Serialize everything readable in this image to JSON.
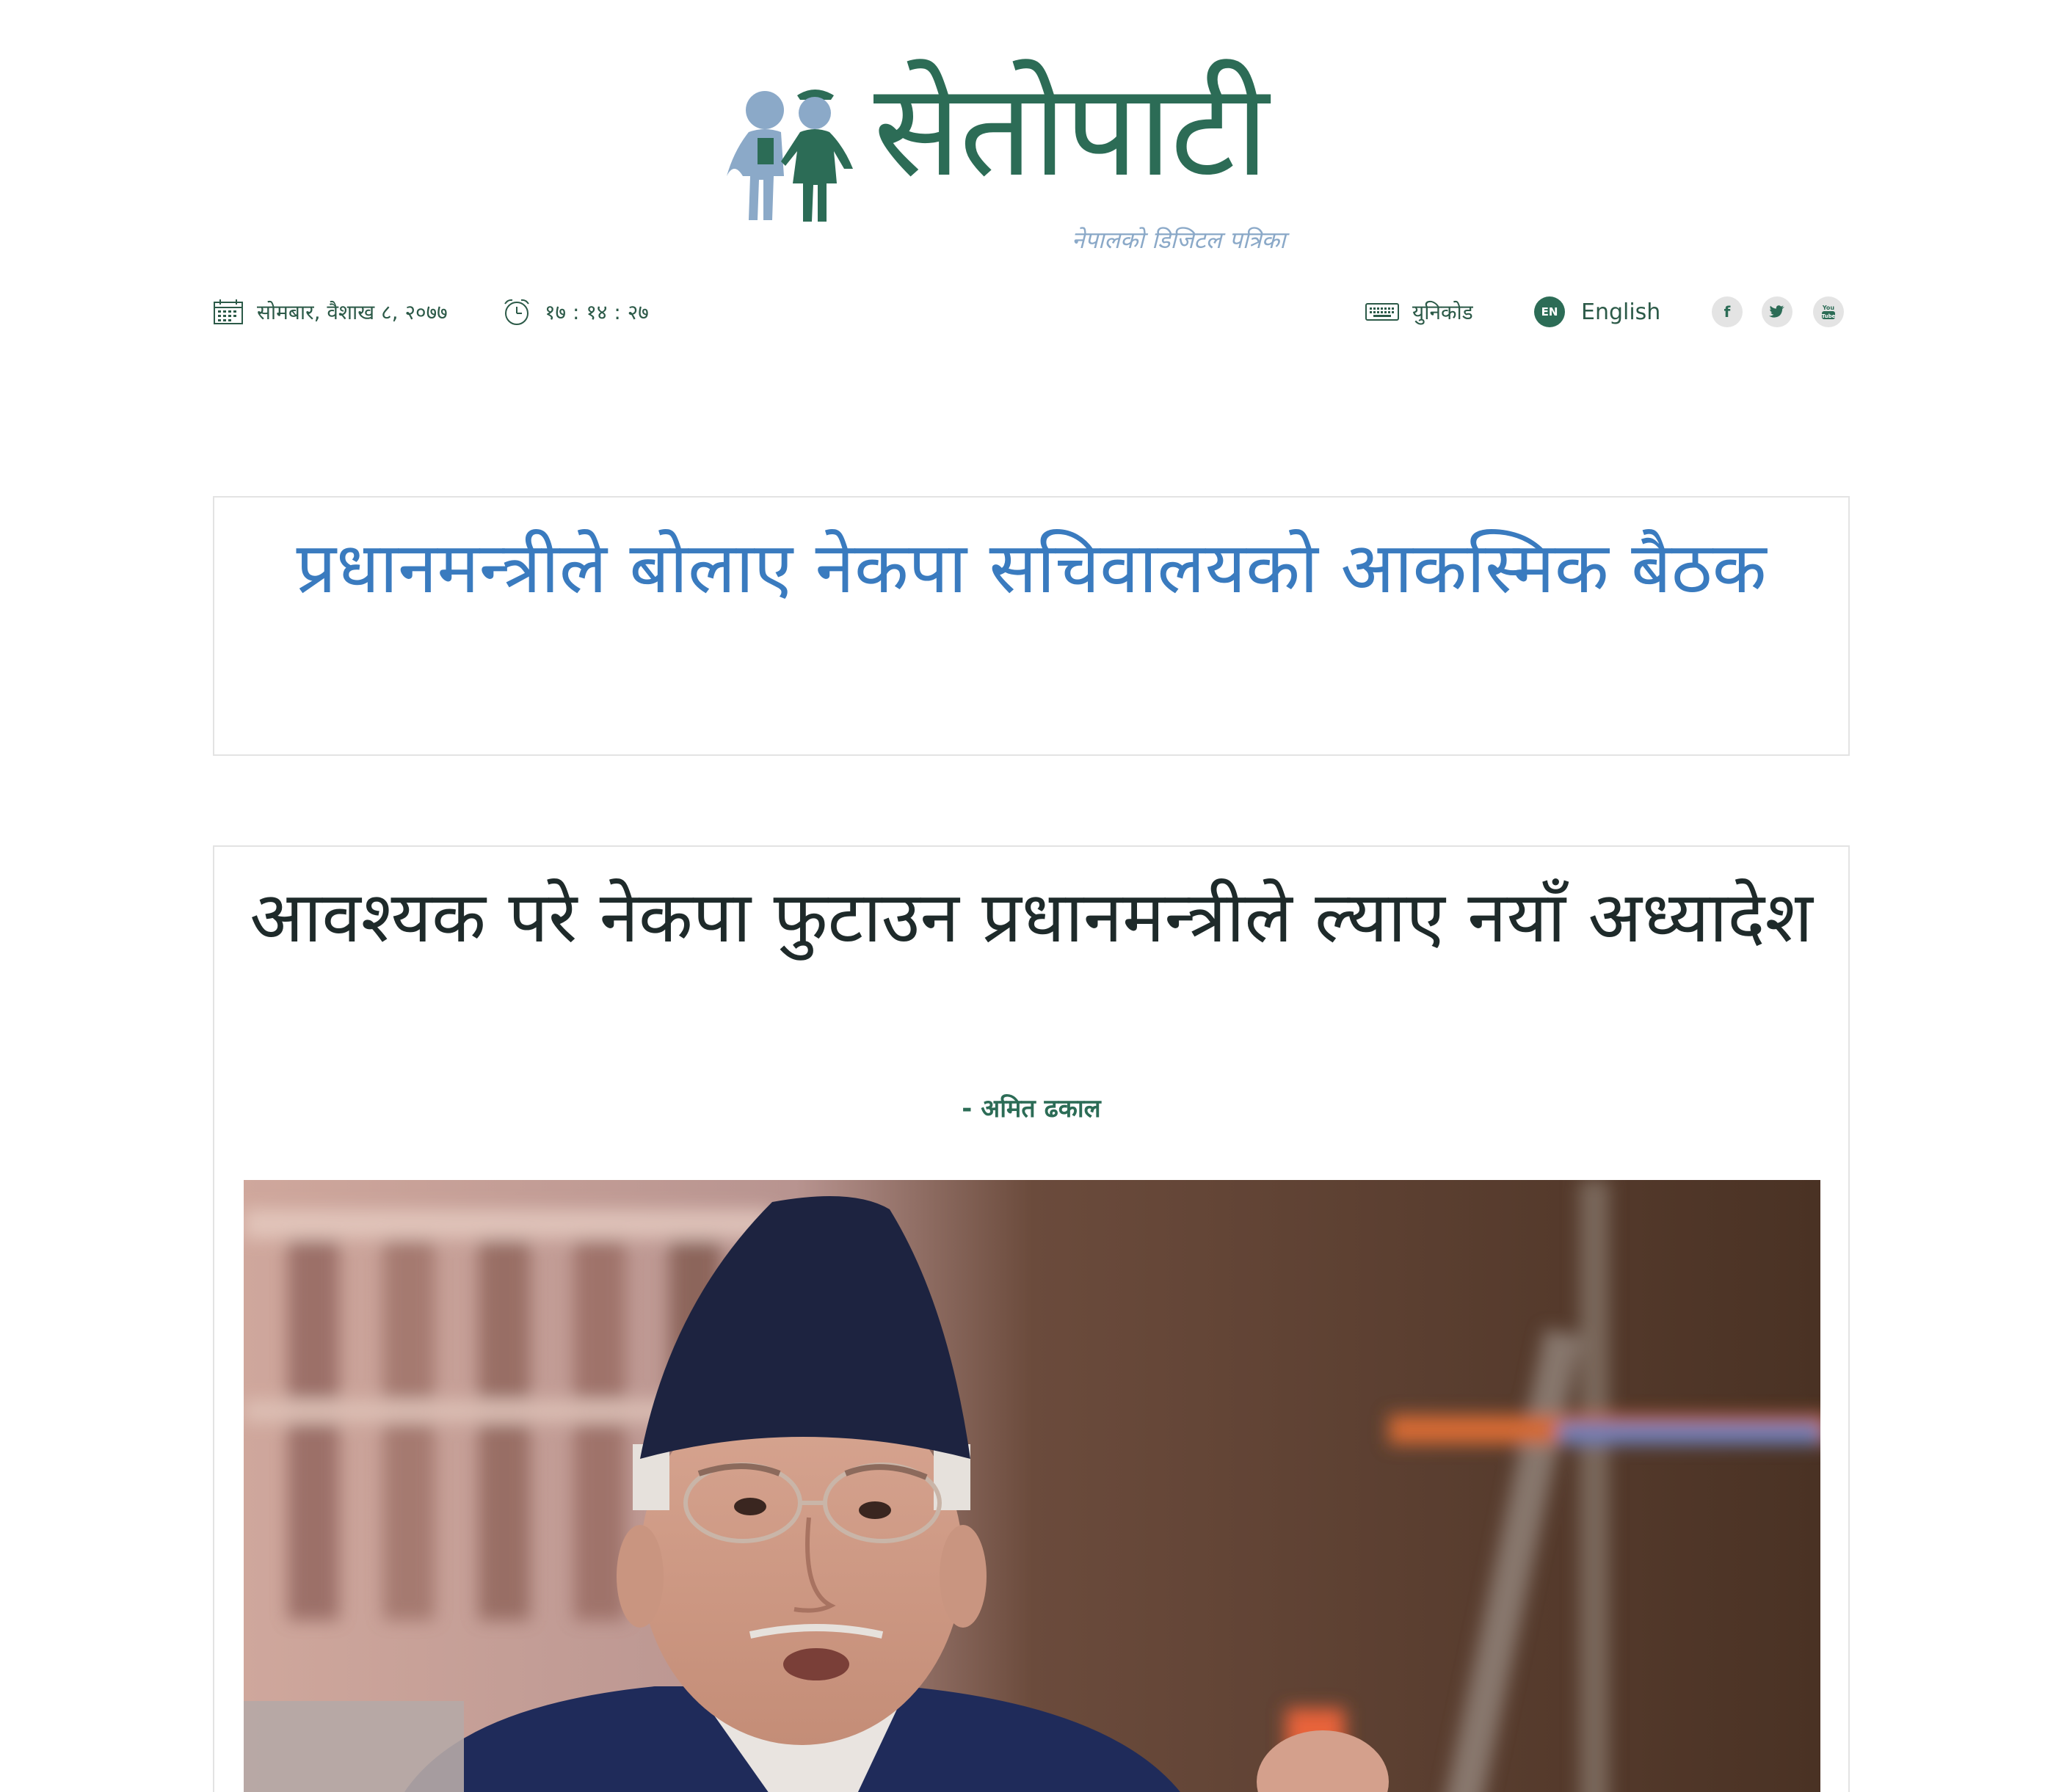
{
  "brand": {
    "logo_text": "सेतोपाटी",
    "tagline": "नेपालको डिजिटल पत्रिका",
    "colors": {
      "primary": "#2c6c56",
      "secondary": "#8ba9c8",
      "link": "#3a7bbf"
    }
  },
  "topbar": {
    "date_icon": "calendar-icon",
    "date": "सोमबार, वैशाख ८, २०७७",
    "clock_icon": "alarm-clock-icon",
    "time": "१७ : १४ : २७",
    "keyboard_icon": "keyboard-icon",
    "unicode_label": "युनिकोड",
    "lang_badge": "EN",
    "lang_label": "English",
    "social": [
      {
        "name": "facebook-icon",
        "glyph": "f"
      },
      {
        "name": "twitter-icon",
        "glyph": "t"
      },
      {
        "name": "youtube-icon",
        "glyph": "You"
      }
    ]
  },
  "breaking": {
    "headline": "प्रधानमन्त्रीले बोलाए नेकपा सचिवालयको आकस्मिक बैठक"
  },
  "article": {
    "headline": "आवश्यक परे नेकपा फुटाउन प्रधानमन्त्रीले ल्याए नयाँ अध्यादेश",
    "byline": "- अमित ढकाल",
    "image_alt": "article-photo"
  }
}
